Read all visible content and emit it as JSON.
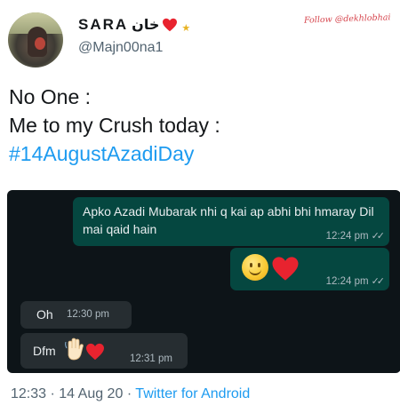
{
  "profile": {
    "name": "SARA",
    "name_urdu": "خان",
    "handle": "@Majn00na1",
    "heart_icon": "red-heart-icon",
    "star_icon": "star-icon"
  },
  "watermark": "Follow @dekhlobhai",
  "tweet": {
    "line1": "No One :",
    "line2": "Me to my Crush today :",
    "hashtag": "#14AugustAzadiDay"
  },
  "chat": {
    "messages": [
      {
        "direction": "outgoing",
        "text": "Apko Azadi Mubarak nhi q kai ap abhi bhi hmaray Dil mai qaid hain",
        "time": "12:24 pm",
        "ticks": "✓✓"
      },
      {
        "direction": "outgoing",
        "emoji": [
          "smiling-face-icon",
          "red-heart-icon"
        ],
        "time": "12:24 pm",
        "ticks": "✓✓"
      },
      {
        "direction": "incoming",
        "text": "Oh",
        "time": "12:30 pm"
      },
      {
        "direction": "incoming",
        "text": "Dfm",
        "emoji": [
          "waving-hand-icon",
          "red-heart-icon"
        ],
        "time": "12:31 pm"
      }
    ]
  },
  "footer": {
    "time": "12:33",
    "date": "14 Aug 20",
    "separator": "·",
    "source": "Twitter for Android"
  },
  "colors": {
    "link_blue": "#1d9bf0",
    "chat_background": "#0d1418",
    "outgoing_bubble": "#054740",
    "incoming_bubble": "#262d31",
    "heart_red": "#e8232f"
  }
}
